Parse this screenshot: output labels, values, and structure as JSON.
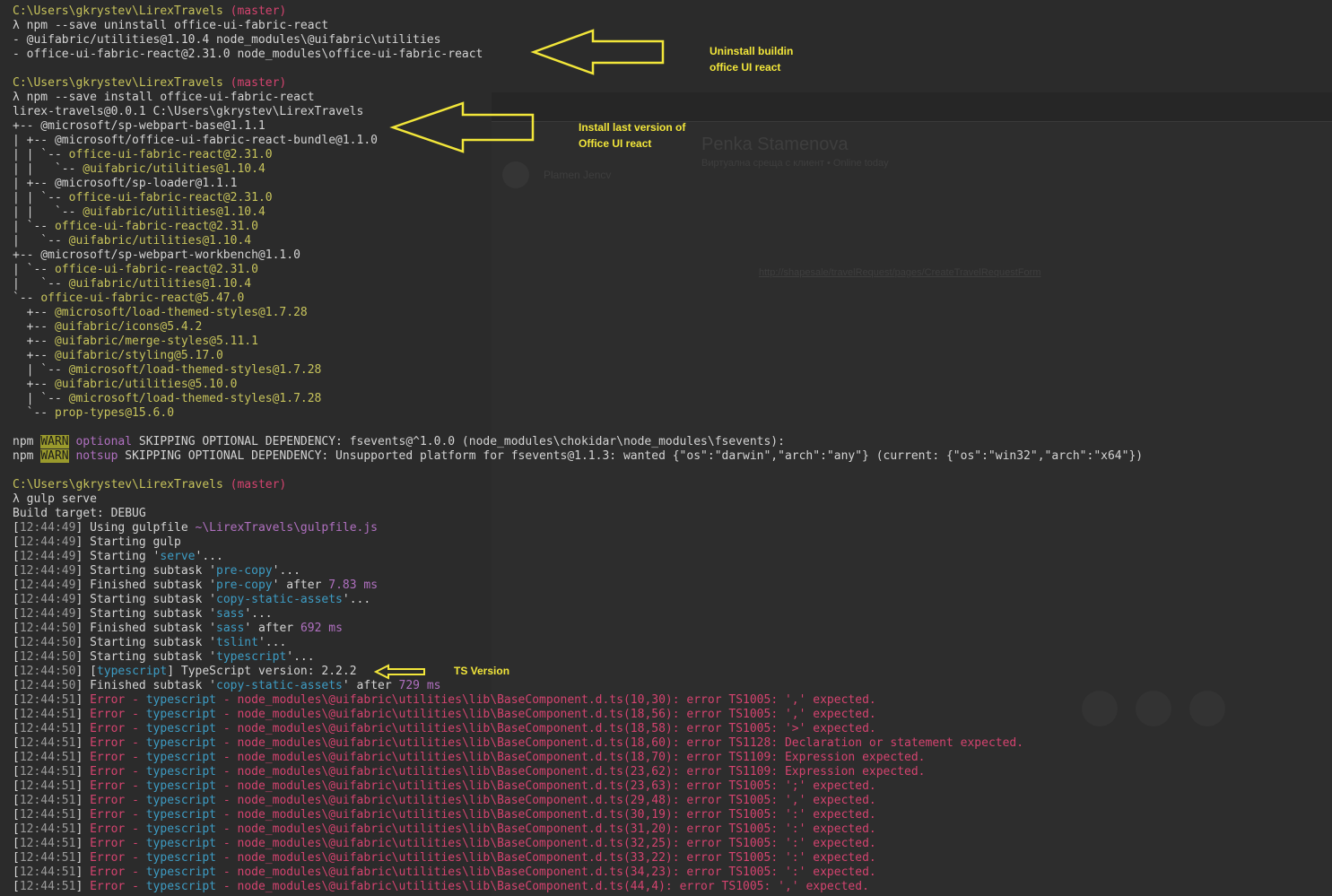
{
  "lines": [
    {
      "segs": [
        {
          "t": "C:\\Users\\gkrystev\\LirexTravels",
          "c": "path"
        },
        {
          "t": " "
        },
        {
          "t": "(master)",
          "c": "branch"
        }
      ]
    },
    {
      "segs": [
        {
          "t": "λ npm --save uninstall office-ui-fabric-react"
        }
      ]
    },
    {
      "segs": [
        {
          "t": "- @uifabric/utilities@1.10.4 node_modules\\@uifabric\\utilities"
        }
      ]
    },
    {
      "segs": [
        {
          "t": "- office-ui-fabric-react@2.31.0 node_modules\\office-ui-fabric-react"
        }
      ]
    },
    {
      "segs": []
    },
    {
      "segs": [
        {
          "t": "C:\\Users\\gkrystev\\LirexTravels",
          "c": "path"
        },
        {
          "t": " "
        },
        {
          "t": "(master)",
          "c": "branch"
        }
      ]
    },
    {
      "segs": [
        {
          "t": "λ npm --save install office-ui-fabric-react"
        }
      ]
    },
    {
      "segs": [
        {
          "t": "lirex-travels@0.0.1 C:\\Users\\gkrystev\\LirexTravels"
        }
      ]
    },
    {
      "segs": [
        {
          "t": "+-- @microsoft/sp-webpart-base@1.1.1"
        }
      ]
    },
    {
      "segs": [
        {
          "t": "| +-- @microsoft/office-ui-fabric-react-bundle@1.1.0"
        }
      ]
    },
    {
      "segs": [
        {
          "t": "| | `-- "
        },
        {
          "t": "office-ui-fabric-react@2.31.0",
          "c": "pkg"
        }
      ]
    },
    {
      "segs": [
        {
          "t": "| |   `-- "
        },
        {
          "t": "@uifabric/utilities@1.10.4",
          "c": "pkg"
        }
      ]
    },
    {
      "segs": [
        {
          "t": "| +-- @microsoft/sp-loader@1.1.1"
        }
      ]
    },
    {
      "segs": [
        {
          "t": "| | `-- "
        },
        {
          "t": "office-ui-fabric-react@2.31.0",
          "c": "pkg"
        }
      ]
    },
    {
      "segs": [
        {
          "t": "| |   `-- "
        },
        {
          "t": "@uifabric/utilities@1.10.4",
          "c": "pkg"
        }
      ]
    },
    {
      "segs": [
        {
          "t": "| `-- "
        },
        {
          "t": "office-ui-fabric-react@2.31.0",
          "c": "pkg"
        }
      ]
    },
    {
      "segs": [
        {
          "t": "|   `-- "
        },
        {
          "t": "@uifabric/utilities@1.10.4",
          "c": "pkg"
        }
      ]
    },
    {
      "segs": [
        {
          "t": "+-- @microsoft/sp-webpart-workbench@1.1.0"
        }
      ]
    },
    {
      "segs": [
        {
          "t": "| `-- "
        },
        {
          "t": "office-ui-fabric-react@2.31.0",
          "c": "pkg"
        }
      ]
    },
    {
      "segs": [
        {
          "t": "|   `-- "
        },
        {
          "t": "@uifabric/utilities@1.10.4",
          "c": "pkg"
        }
      ]
    },
    {
      "segs": [
        {
          "t": "`-- "
        },
        {
          "t": "office-ui-fabric-react@5.47.0",
          "c": "pkg"
        }
      ]
    },
    {
      "segs": [
        {
          "t": "  +-- "
        },
        {
          "t": "@microsoft/load-themed-styles@1.7.28",
          "c": "pkg"
        }
      ]
    },
    {
      "segs": [
        {
          "t": "  +-- "
        },
        {
          "t": "@uifabric/icons@5.4.2",
          "c": "pkg"
        }
      ]
    },
    {
      "segs": [
        {
          "t": "  +-- "
        },
        {
          "t": "@uifabric/merge-styles@5.11.1",
          "c": "pkg"
        }
      ]
    },
    {
      "segs": [
        {
          "t": "  +-- "
        },
        {
          "t": "@uifabric/styling@5.17.0",
          "c": "pkg"
        }
      ]
    },
    {
      "segs": [
        {
          "t": "  | `-- "
        },
        {
          "t": "@microsoft/load-themed-styles@1.7.28",
          "c": "pkg"
        }
      ]
    },
    {
      "segs": [
        {
          "t": "  +-- "
        },
        {
          "t": "@uifabric/utilities@5.10.0",
          "c": "pkg"
        }
      ]
    },
    {
      "segs": [
        {
          "t": "  | `-- "
        },
        {
          "t": "@microsoft/load-themed-styles@1.7.28",
          "c": "pkg"
        }
      ]
    },
    {
      "segs": [
        {
          "t": "  `-- "
        },
        {
          "t": "prop-types@15.6.0",
          "c": "pkg"
        }
      ]
    },
    {
      "segs": []
    },
    {
      "segs": [
        {
          "t": "npm "
        },
        {
          "t": "WARN",
          "c": "warn"
        },
        {
          "t": " "
        },
        {
          "t": "optional",
          "c": "optional"
        },
        {
          "t": " SKIPPING OPTIONAL DEPENDENCY: fsevents@^1.0.0 (node_modules\\chokidar\\node_modules\\fsevents):"
        }
      ]
    },
    {
      "segs": [
        {
          "t": "npm "
        },
        {
          "t": "WARN",
          "c": "warn"
        },
        {
          "t": " "
        },
        {
          "t": "notsup",
          "c": "optional"
        },
        {
          "t": " SKIPPING OPTIONAL DEPENDENCY: Unsupported platform for fsevents@1.1.3: wanted {\"os\":\"darwin\",\"arch\":\"any\"} (current: {\"os\":\"win32\",\"arch\":\"x64\"})"
        }
      ]
    },
    {
      "segs": []
    },
    {
      "segs": [
        {
          "t": "C:\\Users\\gkrystev\\LirexTravels",
          "c": "path"
        },
        {
          "t": " "
        },
        {
          "t": "(master)",
          "c": "branch"
        }
      ]
    },
    {
      "segs": [
        {
          "t": "λ gulp serve"
        }
      ]
    },
    {
      "segs": [
        {
          "t": "Build target: DEBUG"
        }
      ]
    },
    {
      "segs": [
        {
          "t": "["
        },
        {
          "t": "12:44:49",
          "c": "ts"
        },
        {
          "t": "] Using gulpfile "
        },
        {
          "t": "~\\LirexTravels\\gulpfile.js",
          "c": "file"
        }
      ]
    },
    {
      "segs": [
        {
          "t": "["
        },
        {
          "t": "12:44:49",
          "c": "ts"
        },
        {
          "t": "] Starting gulp"
        }
      ]
    },
    {
      "segs": [
        {
          "t": "["
        },
        {
          "t": "12:44:49",
          "c": "ts"
        },
        {
          "t": "] Starting '"
        },
        {
          "t": "serve",
          "c": "cyan"
        },
        {
          "t": "'..."
        }
      ]
    },
    {
      "segs": [
        {
          "t": "["
        },
        {
          "t": "12:44:49",
          "c": "ts"
        },
        {
          "t": "] Starting subtask '"
        },
        {
          "t": "pre-copy",
          "c": "cyan"
        },
        {
          "t": "'..."
        }
      ]
    },
    {
      "segs": [
        {
          "t": "["
        },
        {
          "t": "12:44:49",
          "c": "ts"
        },
        {
          "t": "] Finished subtask '"
        },
        {
          "t": "pre-copy",
          "c": "cyan"
        },
        {
          "t": "' after "
        },
        {
          "t": "7.83 ms",
          "c": "num"
        }
      ]
    },
    {
      "segs": [
        {
          "t": "["
        },
        {
          "t": "12:44:49",
          "c": "ts"
        },
        {
          "t": "] Starting subtask '"
        },
        {
          "t": "copy-static-assets",
          "c": "cyan"
        },
        {
          "t": "'..."
        }
      ]
    },
    {
      "segs": [
        {
          "t": "["
        },
        {
          "t": "12:44:49",
          "c": "ts"
        },
        {
          "t": "] Starting subtask '"
        },
        {
          "t": "sass",
          "c": "cyan"
        },
        {
          "t": "'..."
        }
      ]
    },
    {
      "segs": [
        {
          "t": "["
        },
        {
          "t": "12:44:50",
          "c": "ts"
        },
        {
          "t": "] Finished subtask '"
        },
        {
          "t": "sass",
          "c": "cyan"
        },
        {
          "t": "' after "
        },
        {
          "t": "692 ms",
          "c": "num"
        }
      ]
    },
    {
      "segs": [
        {
          "t": "["
        },
        {
          "t": "12:44:50",
          "c": "ts"
        },
        {
          "t": "] Starting subtask '"
        },
        {
          "t": "tslint",
          "c": "cyan"
        },
        {
          "t": "'..."
        }
      ]
    },
    {
      "segs": [
        {
          "t": "["
        },
        {
          "t": "12:44:50",
          "c": "ts"
        },
        {
          "t": "] Starting subtask '"
        },
        {
          "t": "typescript",
          "c": "cyan"
        },
        {
          "t": "'..."
        }
      ]
    },
    {
      "segs": [
        {
          "t": "["
        },
        {
          "t": "12:44:50",
          "c": "ts"
        },
        {
          "t": "] ["
        },
        {
          "t": "typescript",
          "c": "cyan"
        },
        {
          "t": "] TypeScript version: 2.2.2"
        }
      ]
    },
    {
      "segs": [
        {
          "t": "["
        },
        {
          "t": "12:44:50",
          "c": "ts"
        },
        {
          "t": "] Finished subtask '"
        },
        {
          "t": "copy-static-assets",
          "c": "cyan"
        },
        {
          "t": "' after "
        },
        {
          "t": "729 ms",
          "c": "num"
        }
      ]
    },
    {
      "segs": [
        {
          "t": "["
        },
        {
          "t": "12:44:51",
          "c": "ts"
        },
        {
          "t": "] "
        },
        {
          "t": "Error",
          "c": "err"
        },
        {
          "t": " - ",
          "c": "err"
        },
        {
          "t": "typescript",
          "c": "cyan"
        },
        {
          "t": " - node_modules\\@uifabric\\utilities\\lib\\BaseComponent.d.ts(10,30): error TS1005: ',' expected.",
          "c": "err"
        }
      ]
    },
    {
      "segs": [
        {
          "t": "["
        },
        {
          "t": "12:44:51",
          "c": "ts"
        },
        {
          "t": "] "
        },
        {
          "t": "Error",
          "c": "err"
        },
        {
          "t": " - ",
          "c": "err"
        },
        {
          "t": "typescript",
          "c": "cyan"
        },
        {
          "t": " - node_modules\\@uifabric\\utilities\\lib\\BaseComponent.d.ts(18,56): error TS1005: ',' expected.",
          "c": "err"
        }
      ]
    },
    {
      "segs": [
        {
          "t": "["
        },
        {
          "t": "12:44:51",
          "c": "ts"
        },
        {
          "t": "] "
        },
        {
          "t": "Error",
          "c": "err"
        },
        {
          "t": " - ",
          "c": "err"
        },
        {
          "t": "typescript",
          "c": "cyan"
        },
        {
          "t": " - node_modules\\@uifabric\\utilities\\lib\\BaseComponent.d.ts(18,58): error TS1005: '>' expected.",
          "c": "err"
        }
      ]
    },
    {
      "segs": [
        {
          "t": "["
        },
        {
          "t": "12:44:51",
          "c": "ts"
        },
        {
          "t": "] "
        },
        {
          "t": "Error",
          "c": "err"
        },
        {
          "t": " - ",
          "c": "err"
        },
        {
          "t": "typescript",
          "c": "cyan"
        },
        {
          "t": " - node_modules\\@uifabric\\utilities\\lib\\BaseComponent.d.ts(18,60): error TS1128: Declaration or statement expected.",
          "c": "err"
        }
      ]
    },
    {
      "segs": [
        {
          "t": "["
        },
        {
          "t": "12:44:51",
          "c": "ts"
        },
        {
          "t": "] "
        },
        {
          "t": "Error",
          "c": "err"
        },
        {
          "t": " - ",
          "c": "err"
        },
        {
          "t": "typescript",
          "c": "cyan"
        },
        {
          "t": " - node_modules\\@uifabric\\utilities\\lib\\BaseComponent.d.ts(18,70): error TS1109: Expression expected.",
          "c": "err"
        }
      ]
    },
    {
      "segs": [
        {
          "t": "["
        },
        {
          "t": "12:44:51",
          "c": "ts"
        },
        {
          "t": "] "
        },
        {
          "t": "Error",
          "c": "err"
        },
        {
          "t": " - ",
          "c": "err"
        },
        {
          "t": "typescript",
          "c": "cyan"
        },
        {
          "t": " - node_modules\\@uifabric\\utilities\\lib\\BaseComponent.d.ts(23,62): error TS1109: Expression expected.",
          "c": "err"
        }
      ]
    },
    {
      "segs": [
        {
          "t": "["
        },
        {
          "t": "12:44:51",
          "c": "ts"
        },
        {
          "t": "] "
        },
        {
          "t": "Error",
          "c": "err"
        },
        {
          "t": " - ",
          "c": "err"
        },
        {
          "t": "typescript",
          "c": "cyan"
        },
        {
          "t": " - node_modules\\@uifabric\\utilities\\lib\\BaseComponent.d.ts(23,63): error TS1005: ';' expected.",
          "c": "err"
        }
      ]
    },
    {
      "segs": [
        {
          "t": "["
        },
        {
          "t": "12:44:51",
          "c": "ts"
        },
        {
          "t": "] "
        },
        {
          "t": "Error",
          "c": "err"
        },
        {
          "t": " - ",
          "c": "err"
        },
        {
          "t": "typescript",
          "c": "cyan"
        },
        {
          "t": " - node_modules\\@uifabric\\utilities\\lib\\BaseComponent.d.ts(29,48): error TS1005: ',' expected.",
          "c": "err"
        }
      ]
    },
    {
      "segs": [
        {
          "t": "["
        },
        {
          "t": "12:44:51",
          "c": "ts"
        },
        {
          "t": "] "
        },
        {
          "t": "Error",
          "c": "err"
        },
        {
          "t": " - ",
          "c": "err"
        },
        {
          "t": "typescript",
          "c": "cyan"
        },
        {
          "t": " - node_modules\\@uifabric\\utilities\\lib\\BaseComponent.d.ts(30,19): error TS1005: ':' expected.",
          "c": "err"
        }
      ]
    },
    {
      "segs": [
        {
          "t": "["
        },
        {
          "t": "12:44:51",
          "c": "ts"
        },
        {
          "t": "] "
        },
        {
          "t": "Error",
          "c": "err"
        },
        {
          "t": " - ",
          "c": "err"
        },
        {
          "t": "typescript",
          "c": "cyan"
        },
        {
          "t": " - node_modules\\@uifabric\\utilities\\lib\\BaseComponent.d.ts(31,20): error TS1005: ':' expected.",
          "c": "err"
        }
      ]
    },
    {
      "segs": [
        {
          "t": "["
        },
        {
          "t": "12:44:51",
          "c": "ts"
        },
        {
          "t": "] "
        },
        {
          "t": "Error",
          "c": "err"
        },
        {
          "t": " - ",
          "c": "err"
        },
        {
          "t": "typescript",
          "c": "cyan"
        },
        {
          "t": " - node_modules\\@uifabric\\utilities\\lib\\BaseComponent.d.ts(32,25): error TS1005: ':' expected.",
          "c": "err"
        }
      ]
    },
    {
      "segs": [
        {
          "t": "["
        },
        {
          "t": "12:44:51",
          "c": "ts"
        },
        {
          "t": "] "
        },
        {
          "t": "Error",
          "c": "err"
        },
        {
          "t": " - ",
          "c": "err"
        },
        {
          "t": "typescript",
          "c": "cyan"
        },
        {
          "t": " - node_modules\\@uifabric\\utilities\\lib\\BaseComponent.d.ts(33,22): error TS1005: ':' expected.",
          "c": "err"
        }
      ]
    },
    {
      "segs": [
        {
          "t": "["
        },
        {
          "t": "12:44:51",
          "c": "ts"
        },
        {
          "t": "] "
        },
        {
          "t": "Error",
          "c": "err"
        },
        {
          "t": " - ",
          "c": "err"
        },
        {
          "t": "typescript",
          "c": "cyan"
        },
        {
          "t": " - node_modules\\@uifabric\\utilities\\lib\\BaseComponent.d.ts(34,23): error TS1005: ':' expected.",
          "c": "err"
        }
      ]
    },
    {
      "segs": [
        {
          "t": "["
        },
        {
          "t": "12:44:51",
          "c": "ts"
        },
        {
          "t": "] "
        },
        {
          "t": "Error",
          "c": "err"
        },
        {
          "t": " - ",
          "c": "err"
        },
        {
          "t": "typescript",
          "c": "cyan"
        },
        {
          "t": " - node_modules\\@uifabric\\utilities\\lib\\BaseComponent.d.ts(44,4): error TS1005: ',' expected.",
          "c": "err"
        }
      ]
    }
  ],
  "annotations": {
    "uninstall": {
      "line1": "Uninstall buildin",
      "line2": "office UI react"
    },
    "install": {
      "line1": "Install last version of",
      "line2": "Office UI react"
    },
    "ts_version": {
      "label": "TS Version"
    }
  },
  "background_window": {
    "name1": "Plamen Jencv",
    "name2": "Penka Stamenova",
    "subtitle": "Виртуална среща с клиент • Online today",
    "link": "http://shapesale/travelRequest/pages/CreateTravelRequestForm"
  },
  "colors": {
    "terminal_bg": "#2b2b2b",
    "path": "#c7c35b",
    "branch": "#d4436f",
    "error": "#d4436f",
    "cyan": "#3d9cc4",
    "number": "#b070c0",
    "annotation": "#f2e63a"
  }
}
